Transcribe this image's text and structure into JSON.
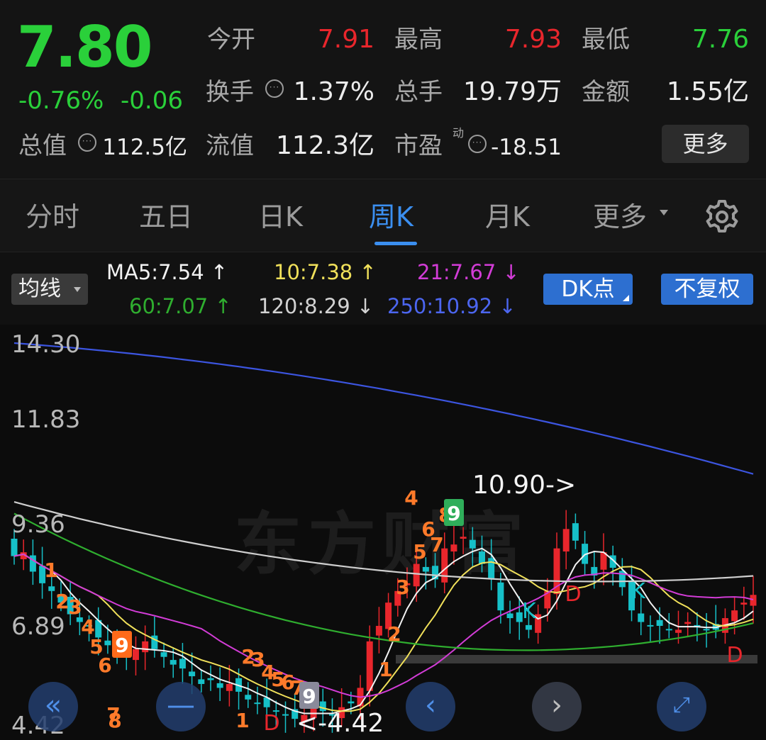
{
  "quote": {
    "price": "7.80",
    "change_pct": "-0.76%",
    "change_abs": "-0.06",
    "open_label": "今开",
    "open": "7.91",
    "high_label": "最高",
    "high": "7.93",
    "low_label": "最低",
    "low": "7.76",
    "turnover_label": "换手",
    "turnover": "1.37%",
    "volume_label": "总手",
    "volume": "19.79万",
    "amount_label": "金额",
    "amount": "1.55亿",
    "total_mv_label": "总值",
    "total_mv": "112.5亿",
    "float_mv_label": "流值",
    "float_mv": "112.3亿",
    "pe_label": "市盈",
    "pe_sup": "动",
    "pe": "-18.51",
    "more_label": "更多"
  },
  "tabs": [
    {
      "label": "分时"
    },
    {
      "label": "五日"
    },
    {
      "label": "日K"
    },
    {
      "label": "周K",
      "active": true
    },
    {
      "label": "月K"
    },
    {
      "label": "更多"
    }
  ],
  "legend": {
    "ma_button": "均线",
    "ma5": "MA5:7.54 ↑",
    "ma10": "10:7.38 ↑",
    "ma21": "21:7.67 ↓",
    "ma60": "60:7.07 ↑",
    "ma120": "120:8.29 ↓",
    "ma250": "250:10.92 ↓",
    "dk_button": "DK点",
    "fq_button": "不复权"
  },
  "colors": {
    "up": "#e8262c",
    "down": "#16c0c8",
    "ma5": "#f2f2f2",
    "ma10": "#f0e05a",
    "ma21": "#d23cd6",
    "ma60": "#2fae2f",
    "ma120": "#cfcfcf",
    "ma250": "#3c55e0",
    "tab_active": "#3b8ff0"
  },
  "chart": {
    "y_ticks": [
      "14.30",
      "11.83",
      "9.36",
      "6.89",
      "4.42"
    ],
    "high_annotation": "10.90->",
    "low_annotation": "<-4.42",
    "watermark": "东方财富",
    "markers": [
      {
        "text": "1",
        "kind": "orange"
      },
      {
        "text": "2",
        "kind": "orange"
      },
      {
        "text": "3",
        "kind": "orange"
      },
      {
        "text": "4",
        "kind": "orange"
      },
      {
        "text": "5",
        "kind": "orange"
      },
      {
        "text": "6",
        "kind": "orange"
      },
      {
        "text": "7",
        "kind": "orange"
      },
      {
        "text": "9",
        "kind": "orange-solid"
      },
      {
        "text": "8",
        "kind": "orange"
      },
      {
        "text": "2",
        "kind": "orange"
      },
      {
        "text": "3",
        "kind": "orange"
      },
      {
        "text": "4",
        "kind": "orange"
      },
      {
        "text": "5",
        "kind": "orange"
      },
      {
        "text": "6",
        "kind": "orange"
      },
      {
        "text": "7",
        "kind": "orange"
      },
      {
        "text": "8",
        "kind": "orange"
      },
      {
        "text": "9",
        "kind": "gray-solid"
      },
      {
        "text": "1",
        "kind": "orange"
      },
      {
        "text": "1",
        "kind": "orange"
      },
      {
        "text": "2",
        "kind": "orange"
      },
      {
        "text": "3",
        "kind": "orange"
      },
      {
        "text": "4",
        "kind": "orange"
      },
      {
        "text": "5",
        "kind": "orange"
      },
      {
        "text": "6",
        "kind": "orange"
      },
      {
        "text": "7",
        "kind": "orange"
      },
      {
        "text": "8",
        "kind": "orange"
      },
      {
        "text": "9",
        "kind": "green-solid"
      }
    ],
    "dk_labels": [
      "D",
      "K",
      "D",
      "K",
      "D"
    ]
  },
  "chart_data": {
    "type": "candlestick",
    "y_axis_ticks": [
      14.3,
      11.83,
      9.36,
      6.89,
      4.42
    ],
    "ylim": [
      4.42,
      14.3
    ],
    "series": [
      {
        "name": "MA5",
        "last": 7.54,
        "trend": "up"
      },
      {
        "name": "10",
        "last": 7.38,
        "trend": "up"
      },
      {
        "name": "21",
        "last": 7.67,
        "trend": "down"
      },
      {
        "name": "60",
        "last": 7.07,
        "trend": "up"
      },
      {
        "name": "120",
        "last": 8.29,
        "trend": "down"
      },
      {
        "name": "250",
        "last": 10.92,
        "trend": "down"
      }
    ],
    "ohlc_close": [
      8.8,
      8.9,
      8.4,
      8.1,
      7.9,
      7.6,
      7.3,
      7.1,
      7.0,
      6.7,
      6.5,
      6.3,
      6.2,
      6.4,
      6.6,
      6.4,
      6.2,
      6.0,
      5.9,
      5.7,
      5.5,
      5.6,
      5.4,
      5.5,
      5.3,
      5.1,
      5.0,
      4.9,
      4.8,
      4.7,
      4.6,
      4.7,
      4.9,
      4.8,
      4.7,
      4.9,
      5.0,
      5.4,
      6.6,
      7.0,
      7.6,
      7.9,
      8.1,
      8.6,
      8.4,
      8.2,
      9.0,
      9.1,
      9.3,
      9.0,
      8.6,
      8.2,
      7.4,
      7.2,
      7.1,
      6.9,
      7.3,
      7.9,
      9.0,
      9.5,
      9.2,
      8.6,
      8.3,
      8.9,
      8.5,
      8.0,
      7.4,
      7.1,
      7.0,
      7.0,
      6.9,
      6.9,
      7.1,
      7.0,
      6.9,
      6.9,
      7.2,
      7.4,
      7.6,
      7.8
    ],
    "annotations": [
      {
        "text": "10.90",
        "value": 10.9
      },
      {
        "text": "4.42",
        "value": 4.42
      }
    ]
  }
}
